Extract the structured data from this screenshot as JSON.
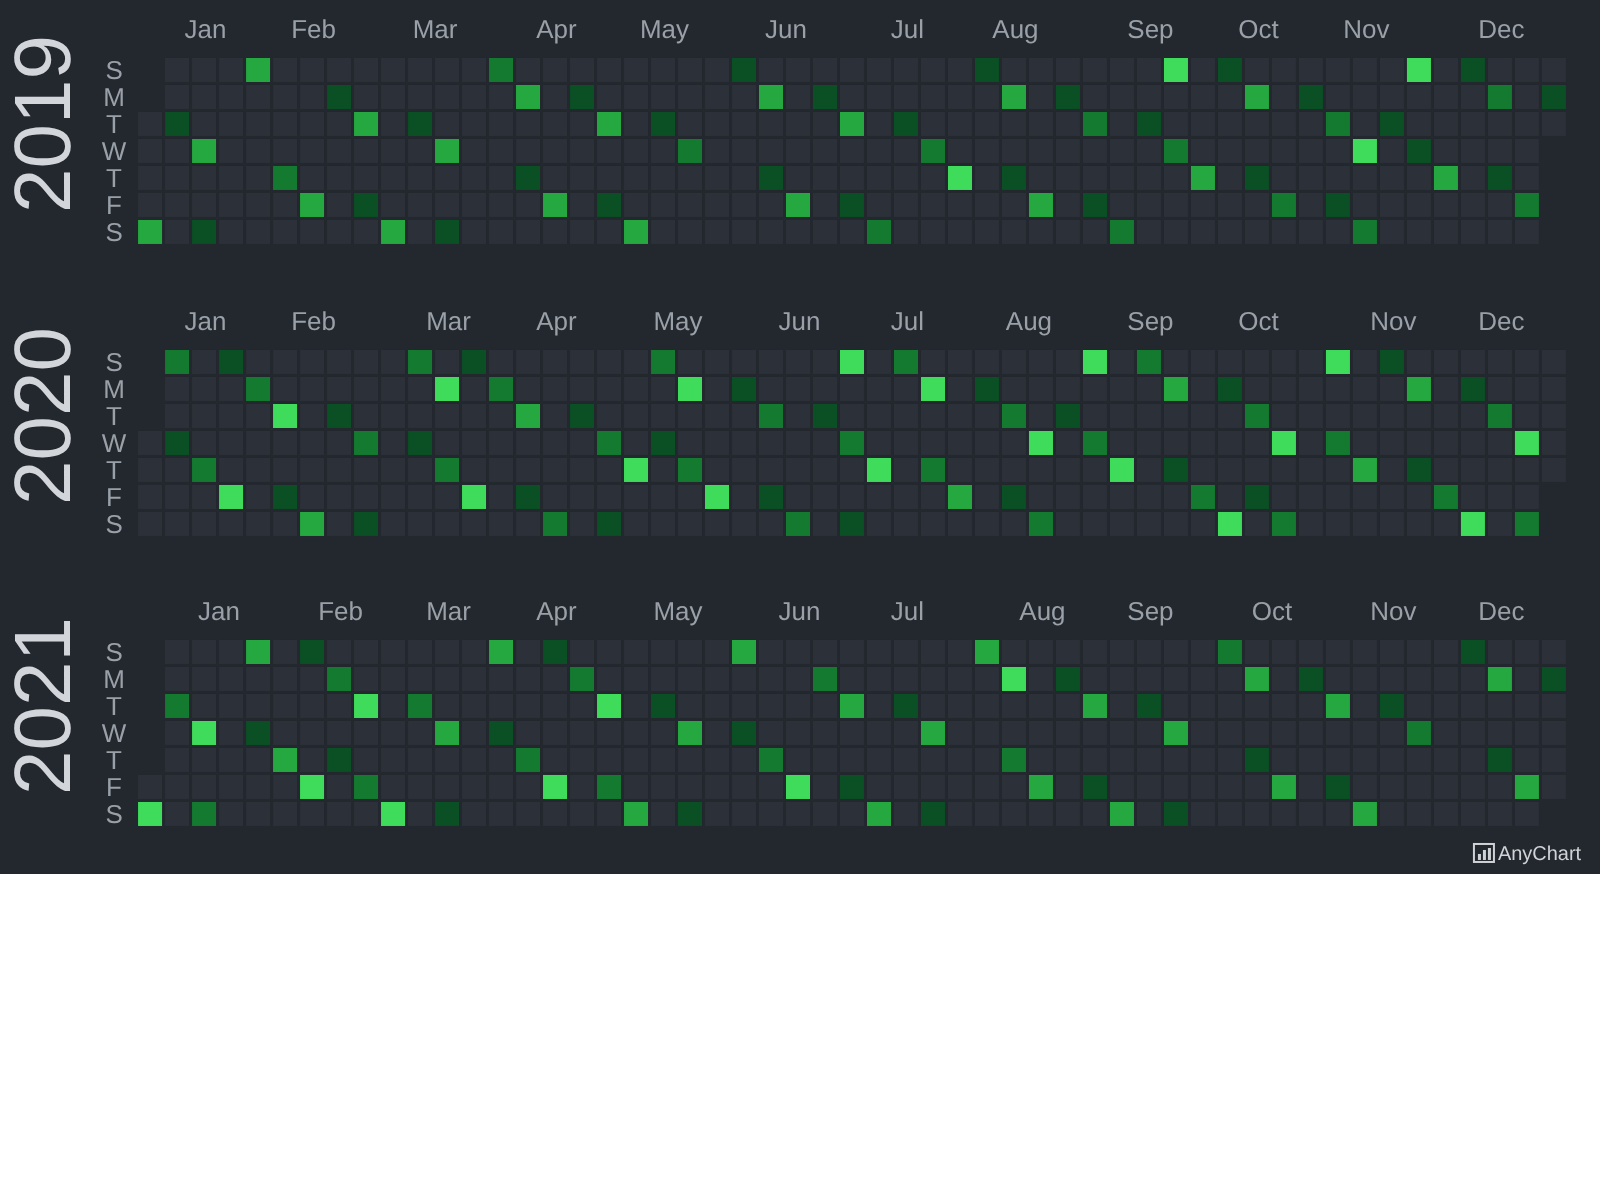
{
  "years": [
    {
      "year": "2019",
      "months": [
        "Jan",
        "Feb",
        "Mar",
        "Apr",
        "May",
        "Jun",
        "Jul",
        "Aug",
        "Sep",
        "Oct",
        "Nov",
        "Dec"
      ],
      "days": [
        "S",
        "M",
        "T",
        "W",
        "T",
        "F",
        "S"
      ]
    },
    {
      "year": "2020",
      "months": [
        "Jan",
        "Feb",
        "Mar",
        "Apr",
        "May",
        "Jun",
        "Jul",
        "Aug",
        "Sep",
        "Oct",
        "Nov",
        "Dec"
      ],
      "days": [
        "S",
        "M",
        "T",
        "W",
        "T",
        "F",
        "S"
      ]
    },
    {
      "year": "2021",
      "months": [
        "Jan",
        "Feb",
        "Mar",
        "Apr",
        "May",
        "Jun",
        "Jul",
        "Aug",
        "Sep",
        "Oct",
        "Nov",
        "Dec"
      ],
      "days": [
        "S",
        "M",
        "T",
        "W",
        "T",
        "F",
        "S"
      ]
    }
  ],
  "credit": "AnyChart"
}
